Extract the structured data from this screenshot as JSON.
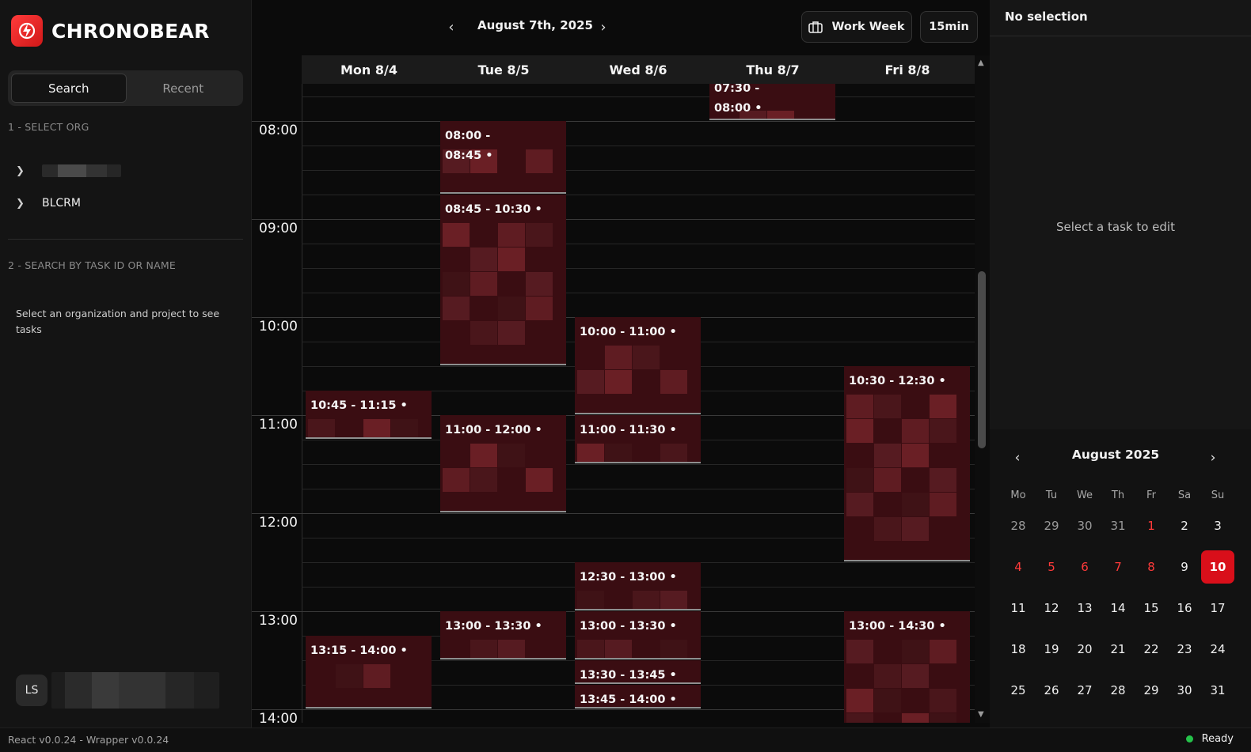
{
  "app": {
    "name": "CHRONOBEAR"
  },
  "sidebar": {
    "tabs": [
      {
        "label": "Search",
        "active": true
      },
      {
        "label": "Recent",
        "active": false
      }
    ],
    "step1_label": "1 - SELECT ORG",
    "orgs": [
      {
        "label": ""
      },
      {
        "label": "BLCRM"
      }
    ],
    "step2_label": "2 - SEARCH BY TASK ID OR NAME",
    "hint": "Select an organization and project to see tasks",
    "user": {
      "initials": "LS"
    }
  },
  "toolbar": {
    "current_date": "August 7th, 2025",
    "view_mode": "Work Week",
    "interval": "15min"
  },
  "calendar": {
    "days": [
      "Mon 8/4",
      "Tue 8/5",
      "Wed 8/6",
      "Thu 8/7",
      "Fri 8/8"
    ],
    "hours": [
      "08:00",
      "09:00",
      "10:00",
      "11:00",
      "12:00",
      "13:00",
      "14:00"
    ],
    "events": [
      {
        "day": 3,
        "start": "07:30",
        "end": "08:00",
        "label": "07:30 -\n08:00 •"
      },
      {
        "day": 1,
        "start": "08:00",
        "end": "08:45",
        "label": "08:00 -\n08:45 •"
      },
      {
        "day": 1,
        "start": "08:45",
        "end": "10:30",
        "label": "08:45 - 10:30 •"
      },
      {
        "day": 2,
        "start": "10:00",
        "end": "11:00",
        "label": "10:00 - 11:00 •"
      },
      {
        "day": 4,
        "start": "10:30",
        "end": "12:30",
        "label": "10:30 - 12:30 •"
      },
      {
        "day": 0,
        "start": "10:45",
        "end": "11:15",
        "label": "10:45 - 11:15 •"
      },
      {
        "day": 1,
        "start": "11:00",
        "end": "12:00",
        "label": "11:00 - 12:00 •"
      },
      {
        "day": 2,
        "start": "11:00",
        "end": "11:30",
        "label": "11:00 - 11:30 •"
      },
      {
        "day": 2,
        "start": "12:30",
        "end": "13:00",
        "label": "12:30 - 13:00 •"
      },
      {
        "day": 1,
        "start": "13:00",
        "end": "13:30",
        "label": "13:00 - 13:30 •"
      },
      {
        "day": 2,
        "start": "13:00",
        "end": "13:30",
        "label": "13:00 - 13:30 •"
      },
      {
        "day": 4,
        "start": "13:00",
        "end": "14:30",
        "label": "13:00 - 14:30 •"
      },
      {
        "day": 0,
        "start": "13:15",
        "end": "14:00",
        "label": "13:15 - 14:00 •"
      },
      {
        "day": 2,
        "start": "13:30",
        "end": "13:45",
        "label": "13:30 - 13:45 •"
      },
      {
        "day": 2,
        "start": "13:45",
        "end": "14:00",
        "label": "13:45 - 14:00 •"
      }
    ]
  },
  "panel": {
    "title": "No selection",
    "hint": "Select a task to edit"
  },
  "mini_calendar": {
    "title": "August 2025",
    "weekdays": [
      "Mo",
      "Tu",
      "We",
      "Th",
      "Fr",
      "Sa",
      "Su"
    ],
    "days": [
      {
        "d": "28",
        "kind": "muted"
      },
      {
        "d": "29",
        "kind": "muted"
      },
      {
        "d": "30",
        "kind": "muted"
      },
      {
        "d": "31",
        "kind": "muted"
      },
      {
        "d": "1",
        "kind": "red"
      },
      {
        "d": "2",
        "kind": ""
      },
      {
        "d": "3",
        "kind": ""
      },
      {
        "d": "4",
        "kind": "red"
      },
      {
        "d": "5",
        "kind": "red"
      },
      {
        "d": "6",
        "kind": "red"
      },
      {
        "d": "7",
        "kind": "red"
      },
      {
        "d": "8",
        "kind": "red"
      },
      {
        "d": "9",
        "kind": ""
      },
      {
        "d": "10",
        "kind": "sel"
      },
      {
        "d": "11",
        "kind": ""
      },
      {
        "d": "12",
        "kind": ""
      },
      {
        "d": "13",
        "kind": ""
      },
      {
        "d": "14",
        "kind": ""
      },
      {
        "d": "15",
        "kind": ""
      },
      {
        "d": "16",
        "kind": ""
      },
      {
        "d": "17",
        "kind": ""
      },
      {
        "d": "18",
        "kind": ""
      },
      {
        "d": "19",
        "kind": ""
      },
      {
        "d": "20",
        "kind": ""
      },
      {
        "d": "21",
        "kind": ""
      },
      {
        "d": "22",
        "kind": ""
      },
      {
        "d": "23",
        "kind": ""
      },
      {
        "d": "24",
        "kind": ""
      },
      {
        "d": "25",
        "kind": ""
      },
      {
        "d": "26",
        "kind": ""
      },
      {
        "d": "27",
        "kind": ""
      },
      {
        "d": "28",
        "kind": ""
      },
      {
        "d": "29",
        "kind": ""
      },
      {
        "d": "30",
        "kind": ""
      },
      {
        "d": "31",
        "kind": ""
      }
    ]
  },
  "status": {
    "version": "React v0.0.24 - Wrapper v0.0.24",
    "state": "Ready"
  },
  "colors": {
    "accent": "#d90f1a",
    "event_bg": "#3a0d12",
    "ready": "#25c24a"
  }
}
